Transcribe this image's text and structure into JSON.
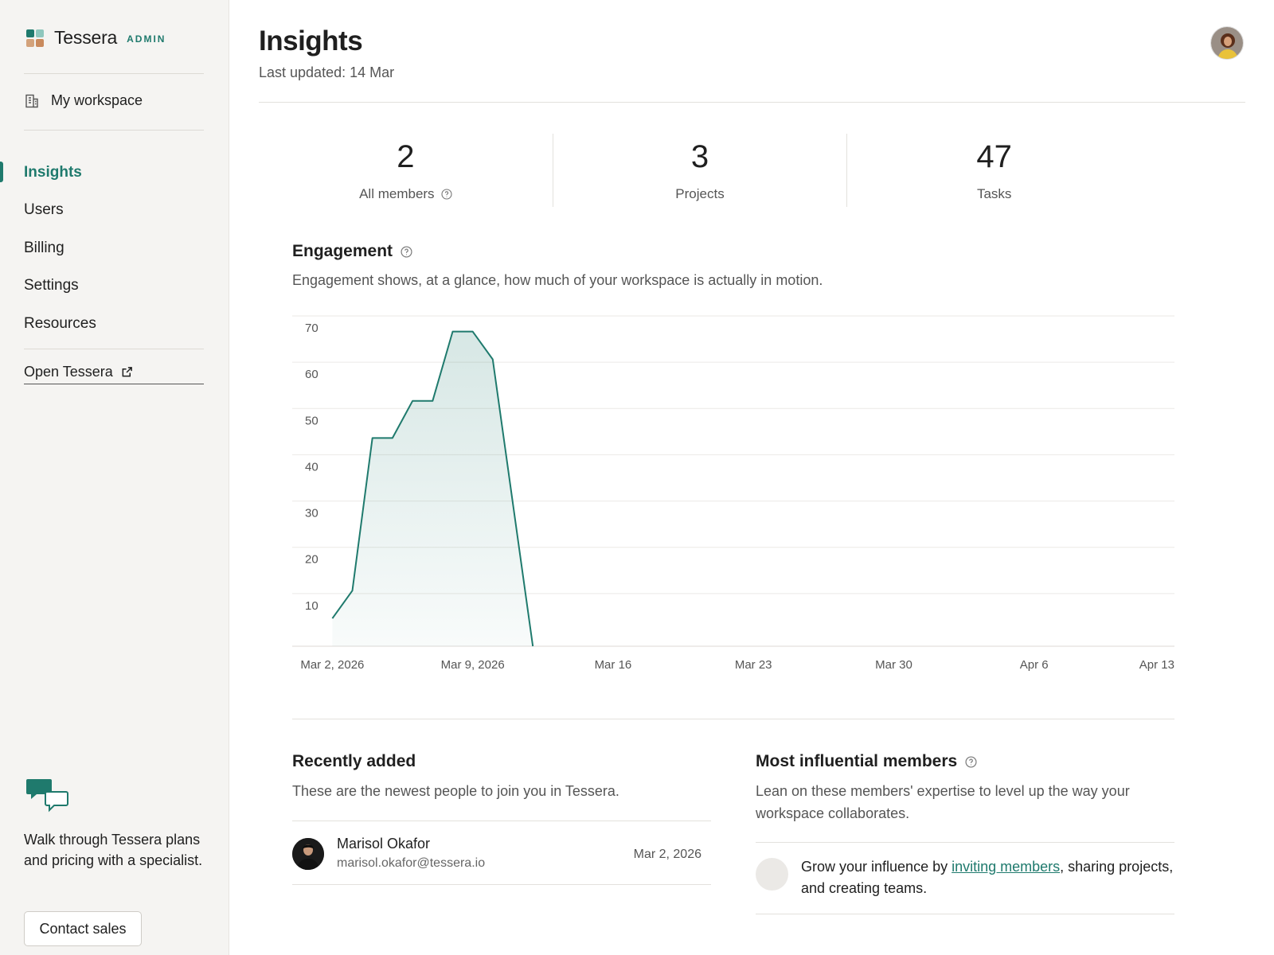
{
  "app": {
    "brand": "Tessera",
    "badge": "ADMIN",
    "accent_color": "#1f7a6d"
  },
  "sidebar": {
    "workspace_label": "My workspace",
    "nav": [
      {
        "label": "Insights",
        "active": true
      },
      {
        "label": "Users",
        "active": false
      },
      {
        "label": "Billing",
        "active": false
      },
      {
        "label": "Settings",
        "active": false
      },
      {
        "label": "Resources",
        "active": false
      }
    ],
    "open_app_label": "Open Tessera",
    "promo_text": "Walk through Tessera plans and pricing with a specialist.",
    "contact_button": "Contact sales"
  },
  "header": {
    "title": "Insights",
    "last_updated": "Last updated: 14 Mar"
  },
  "stats": [
    {
      "value": "2",
      "label": "All members",
      "has_help": true
    },
    {
      "value": "3",
      "label": "Projects",
      "has_help": false
    },
    {
      "value": "47",
      "label": "Tasks",
      "has_help": false
    }
  ],
  "engagement": {
    "title": "Engagement",
    "description": "Engagement shows, at a glance, how much of your workspace is actually in motion."
  },
  "chart_data": {
    "type": "area",
    "title": "",
    "xlabel": "",
    "ylabel": "",
    "x_tick_labels": [
      "Mar 2, 2026",
      "Mar 9, 2026",
      "Mar 16",
      "Mar 23",
      "Mar 30",
      "Apr 6",
      "Apr 13"
    ],
    "x_tick_dates": [
      "2026-03-02",
      "2026-03-09",
      "2026-03-16",
      "2026-03-23",
      "2026-03-30",
      "2026-04-06",
      "2026-04-13"
    ],
    "xlim": [
      "2026-02-28",
      "2026-04-13"
    ],
    "y_ticks": [
      10,
      20,
      30,
      40,
      50,
      60,
      70
    ],
    "ylim": [
      0,
      70
    ],
    "grid": true,
    "series": [
      {
        "x": [
          "2026-03-02",
          "2026-03-03",
          "2026-03-04",
          "2026-03-05",
          "2026-03-06",
          "2026-03-07",
          "2026-03-08",
          "2026-03-09",
          "2026-03-10",
          "2026-03-11",
          "2026-03-12",
          "2026-03-13",
          "2026-03-14",
          "2026-03-14"
        ],
        "values": [
          6,
          12,
          45,
          45,
          53,
          53,
          68,
          68,
          62,
          31,
          0,
          0,
          0,
          0
        ]
      }
    ]
  },
  "recently_added": {
    "title": "Recently added",
    "description": "These are the newest people to join you in Tessera.",
    "members": [
      {
        "name": "Marisol Okafor",
        "email": "marisol.okafor@tessera.io",
        "date": "Mar 2, 2026"
      }
    ]
  },
  "influential": {
    "title": "Most influential members",
    "description": "Lean on these members' expertise to level up the way your workspace collaborates.",
    "empty_prefix": "Grow your influence by ",
    "empty_link": "inviting members",
    "empty_suffix": ", sharing projects, and creating teams."
  }
}
